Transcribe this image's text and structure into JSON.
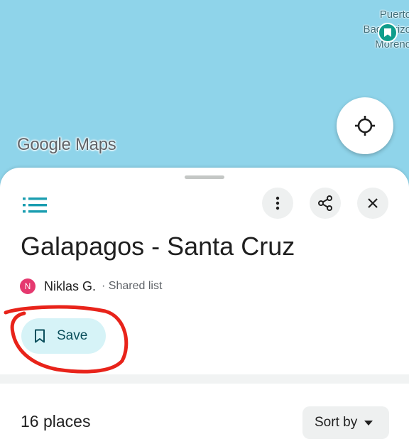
{
  "map": {
    "place_label_lines": [
      "Puerto",
      "Baquerizo",
      "Moreno"
    ],
    "logo_text": "Google Maps",
    "locate_icon": "my-location-icon",
    "background_color": "#8fd4ea"
  },
  "sheet": {
    "list_icon": "list-icon",
    "more_icon": "more-vert-icon",
    "share_icon": "share-icon",
    "close_icon": "close-icon",
    "title": "Galapagos - Santa Cruz",
    "owner": {
      "avatar_initial": "N",
      "avatar_color": "#e5396f",
      "name": "Niklas G.",
      "list_type": "· Shared list"
    },
    "save_label": "Save",
    "places_count": "16 places",
    "sort_label": "Sort by"
  },
  "colors": {
    "accent": "#1a9db0",
    "save_bg": "#d6f3f7",
    "annotation": "#e8231a"
  }
}
